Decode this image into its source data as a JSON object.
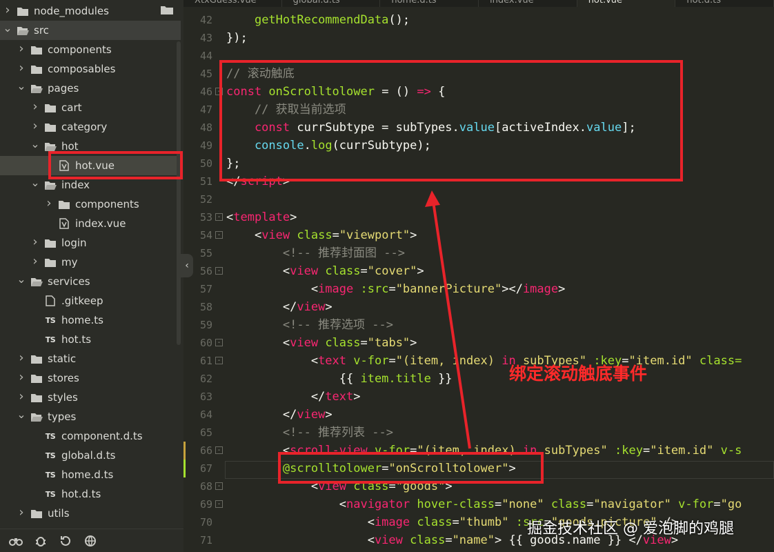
{
  "colors": {
    "annotation_red": "#e8232a",
    "keyword": "#f92672",
    "function": "#66d9ef",
    "string": "#e6db74",
    "comment": "#8a8a80"
  },
  "tabs": [
    {
      "label": "XtxGuess.vue"
    },
    {
      "label": "global.d.ts"
    },
    {
      "label": "home.d.ts"
    },
    {
      "label": "index.vue"
    },
    {
      "label": "hot.vue"
    },
    {
      "label": "hot.d.ts"
    }
  ],
  "explorer": {
    "rows": [
      {
        "label": "node_modules",
        "icon": "folder-icon",
        "chevron": "right"
      },
      {
        "label": "src",
        "icon": "folder-open-icon",
        "chevron": "down"
      },
      {
        "label": "components",
        "icon": "folder-icon",
        "chevron": "right"
      },
      {
        "label": "composables",
        "icon": "folder-icon",
        "chevron": "right"
      },
      {
        "label": "pages",
        "icon": "folder-open-icon",
        "chevron": "down"
      },
      {
        "label": "cart",
        "icon": "folder-icon",
        "chevron": "right"
      },
      {
        "label": "category",
        "icon": "folder-icon",
        "chevron": "right"
      },
      {
        "label": "hot",
        "icon": "folder-open-icon",
        "chevron": "down"
      },
      {
        "label": "hot.vue",
        "icon": "vue-file-icon",
        "chevron": "none"
      },
      {
        "label": "index",
        "icon": "folder-open-icon",
        "chevron": "down"
      },
      {
        "label": "components",
        "icon": "folder-icon",
        "chevron": "right"
      },
      {
        "label": "index.vue",
        "icon": "vue-file-icon",
        "chevron": "none"
      },
      {
        "label": "login",
        "icon": "folder-icon",
        "chevron": "right"
      },
      {
        "label": "my",
        "icon": "folder-icon",
        "chevron": "right"
      },
      {
        "label": "services",
        "icon": "folder-open-icon",
        "chevron": "down"
      },
      {
        "label": ".gitkeep",
        "icon": "file-icon",
        "chevron": "none"
      },
      {
        "label": "home.ts",
        "icon": "ts-file-icon",
        "chevron": "none"
      },
      {
        "label": "hot.ts",
        "icon": "ts-file-icon",
        "chevron": "none"
      },
      {
        "label": "static",
        "icon": "folder-icon",
        "chevron": "right"
      },
      {
        "label": "stores",
        "icon": "folder-icon",
        "chevron": "right"
      },
      {
        "label": "styles",
        "icon": "folder-icon",
        "chevron": "right"
      },
      {
        "label": "types",
        "icon": "folder-open-icon",
        "chevron": "down"
      },
      {
        "label": "component.d.ts",
        "icon": "ts-file-icon",
        "chevron": "none"
      },
      {
        "label": "global.d.ts",
        "icon": "ts-file-icon",
        "chevron": "none"
      },
      {
        "label": "home.d.ts",
        "icon": "ts-file-icon",
        "chevron": "none"
      },
      {
        "label": "hot.d.ts",
        "icon": "ts-file-icon",
        "chevron": "none"
      },
      {
        "label": "utils",
        "icon": "folder-icon",
        "chevron": "right"
      }
    ],
    "ts_badge": "TS",
    "collapse_glyph": "‹"
  },
  "editor": {
    "lines": [
      {
        "no": "42",
        "fold": "",
        "tokens": [
          [
            "p",
            "    "
          ],
          [
            "fn",
            "getHotRecommendData"
          ],
          [
            "p",
            "();"
          ]
        ]
      },
      {
        "no": "43",
        "fold": "",
        "tokens": [
          [
            "p",
            "});"
          ]
        ]
      },
      {
        "no": "44",
        "fold": "",
        "tokens": []
      },
      {
        "no": "45",
        "fold": "",
        "tokens": [
          [
            "c",
            "// 滚动触底"
          ]
        ]
      },
      {
        "no": "46",
        "fold": "-",
        "tokens": [
          [
            "k",
            "const "
          ],
          [
            "fn",
            "onScrolltolower"
          ],
          [
            "p",
            " = () "
          ],
          [
            "k",
            "=>"
          ],
          [
            "p",
            " {"
          ]
        ]
      },
      {
        "no": "47",
        "fold": "",
        "tokens": [
          [
            "c",
            "    // 获取当前选项"
          ]
        ]
      },
      {
        "no": "48",
        "fold": "",
        "tokens": [
          [
            "k",
            "    const "
          ],
          [
            "p",
            "currSubtype = subTypes."
          ],
          [
            "f",
            "value"
          ],
          [
            "p",
            "[activeIndex."
          ],
          [
            "f",
            "value"
          ],
          [
            "p",
            "];"
          ]
        ]
      },
      {
        "no": "49",
        "fold": "",
        "tokens": [
          [
            "f",
            "    console"
          ],
          [
            "p",
            "."
          ],
          [
            "fn",
            "log"
          ],
          [
            "p",
            "(currSubtype);"
          ]
        ]
      },
      {
        "no": "50",
        "fold": "",
        "tokens": [
          [
            "p",
            "};"
          ]
        ]
      },
      {
        "no": "51",
        "fold": "",
        "tokens": [
          [
            "p",
            "</"
          ],
          [
            "t",
            "script"
          ],
          [
            "p",
            ">"
          ]
        ]
      },
      {
        "no": "52",
        "fold": "",
        "tokens": []
      },
      {
        "no": "53",
        "fold": "-",
        "tokens": [
          [
            "p",
            "<"
          ],
          [
            "t",
            "template"
          ],
          [
            "p",
            ">"
          ]
        ]
      },
      {
        "no": "54",
        "fold": "-",
        "tokens": [
          [
            "p",
            "    <"
          ],
          [
            "t",
            "view "
          ],
          [
            "a",
            "class"
          ],
          [
            "p",
            "="
          ],
          [
            "s",
            "\"viewport\""
          ],
          [
            "p",
            ">"
          ]
        ]
      },
      {
        "no": "55",
        "fold": "",
        "tokens": [
          [
            "c",
            "        <!-- 推荐封面图 -->"
          ]
        ]
      },
      {
        "no": "56",
        "fold": "-",
        "tokens": [
          [
            "p",
            "        <"
          ],
          [
            "t",
            "view "
          ],
          [
            "a",
            "class"
          ],
          [
            "p",
            "="
          ],
          [
            "s",
            "\"cover\""
          ],
          [
            "p",
            ">"
          ]
        ]
      },
      {
        "no": "57",
        "fold": "",
        "tokens": [
          [
            "p",
            "            <"
          ],
          [
            "t",
            "image "
          ],
          [
            "a",
            ":src"
          ],
          [
            "p",
            "="
          ],
          [
            "s",
            "\"bannerPicture\""
          ],
          [
            "p",
            "></"
          ],
          [
            "t",
            "image"
          ],
          [
            "p",
            ">"
          ]
        ]
      },
      {
        "no": "58",
        "fold": "",
        "tokens": [
          [
            "p",
            "        </"
          ],
          [
            "t",
            "view"
          ],
          [
            "p",
            ">"
          ]
        ]
      },
      {
        "no": "59",
        "fold": "",
        "tokens": [
          [
            "c",
            "        <!-- 推荐选项 -->"
          ]
        ]
      },
      {
        "no": "60",
        "fold": "-",
        "tokens": [
          [
            "p",
            "        <"
          ],
          [
            "t",
            "view "
          ],
          [
            "a",
            "class"
          ],
          [
            "p",
            "="
          ],
          [
            "s",
            "\"tabs\""
          ],
          [
            "p",
            ">"
          ]
        ]
      },
      {
        "no": "61",
        "fold": "-",
        "tokens": [
          [
            "p",
            "            <"
          ],
          [
            "t",
            "text "
          ],
          [
            "a",
            "v-for"
          ],
          [
            "p",
            "="
          ],
          [
            "s",
            "\"(item, index) "
          ],
          [
            "k",
            "in"
          ],
          [
            "s",
            " subTypes\""
          ],
          [
            "p",
            " "
          ],
          [
            "a",
            ":key"
          ],
          [
            "p",
            "="
          ],
          [
            "s",
            "\"item.id\""
          ],
          [
            "p",
            " "
          ],
          [
            "a",
            "class="
          ]
        ]
      },
      {
        "no": "62",
        "fold": "",
        "tokens": [
          [
            "p",
            "                {{ "
          ],
          [
            "fn",
            "item.title"
          ],
          [
            "p",
            " }}"
          ]
        ]
      },
      {
        "no": "63",
        "fold": "",
        "tokens": [
          [
            "p",
            "            </"
          ],
          [
            "t",
            "text"
          ],
          [
            "p",
            ">"
          ]
        ]
      },
      {
        "no": "64",
        "fold": "",
        "tokens": [
          [
            "p",
            "        </"
          ],
          [
            "t",
            "view"
          ],
          [
            "p",
            ">"
          ]
        ]
      },
      {
        "no": "65",
        "fold": "",
        "tokens": [
          [
            "c",
            "        <!-- 推荐列表 -->"
          ]
        ]
      },
      {
        "no": "66",
        "fold": "-",
        "tokens": [
          [
            "p",
            "        <"
          ],
          [
            "t",
            "scroll-view "
          ],
          [
            "a",
            "v-for"
          ],
          [
            "p",
            "="
          ],
          [
            "s",
            "\"(item, index) "
          ],
          [
            "k",
            "in"
          ],
          [
            "s",
            " subTypes\""
          ],
          [
            "p",
            " "
          ],
          [
            "a",
            ":key"
          ],
          [
            "p",
            "="
          ],
          [
            "s",
            "\"item.id\""
          ],
          [
            "p",
            " "
          ],
          [
            "a",
            "v-s"
          ]
        ]
      },
      {
        "no": "67",
        "fold": "",
        "tokens": [
          [
            "p",
            "        "
          ],
          [
            "a",
            "@scrolltolower"
          ],
          [
            "p",
            "="
          ],
          [
            "s",
            "\"onScrolltolower\""
          ],
          [
            "p",
            ">"
          ]
        ]
      },
      {
        "no": "68",
        "fold": "-",
        "tokens": [
          [
            "p",
            "            <"
          ],
          [
            "t",
            "view "
          ],
          [
            "a",
            "class"
          ],
          [
            "p",
            "="
          ],
          [
            "s",
            "\"goods\""
          ],
          [
            "p",
            ">"
          ]
        ]
      },
      {
        "no": "69",
        "fold": "-",
        "tokens": [
          [
            "p",
            "                <"
          ],
          [
            "t",
            "navigator "
          ],
          [
            "a",
            "hover-class"
          ],
          [
            "p",
            "="
          ],
          [
            "s",
            "\"none\""
          ],
          [
            "p",
            " "
          ],
          [
            "a",
            "class"
          ],
          [
            "p",
            "="
          ],
          [
            "s",
            "\"navigator\""
          ],
          [
            "p",
            " "
          ],
          [
            "a",
            "v-for"
          ],
          [
            "p",
            "="
          ],
          [
            "s",
            "\"go"
          ]
        ]
      },
      {
        "no": "70",
        "fold": "",
        "tokens": [
          [
            "p",
            "                    <"
          ],
          [
            "t",
            "image "
          ],
          [
            "a",
            "class"
          ],
          [
            "p",
            "="
          ],
          [
            "s",
            "\"thumb\""
          ],
          [
            "p",
            " "
          ],
          [
            "a",
            ":src"
          ],
          [
            "p",
            "="
          ],
          [
            "s",
            "\"goods.picture\""
          ],
          [
            "p",
            " />"
          ]
        ]
      },
      {
        "no": "71",
        "fold": "",
        "tokens": [
          [
            "p",
            "                    <"
          ],
          [
            "t",
            "view "
          ],
          [
            "a",
            "class"
          ],
          [
            "p",
            "="
          ],
          [
            "s",
            "\"name\""
          ],
          [
            "p",
            "> {{ goods.name }} </"
          ],
          [
            "t",
            "view"
          ],
          [
            "p",
            ">"
          ]
        ]
      }
    ]
  },
  "annotation": {
    "label": "绑定滚动触底事件"
  },
  "watermark": "掘金技术社区 @ 爱泡脚的鸡腿"
}
